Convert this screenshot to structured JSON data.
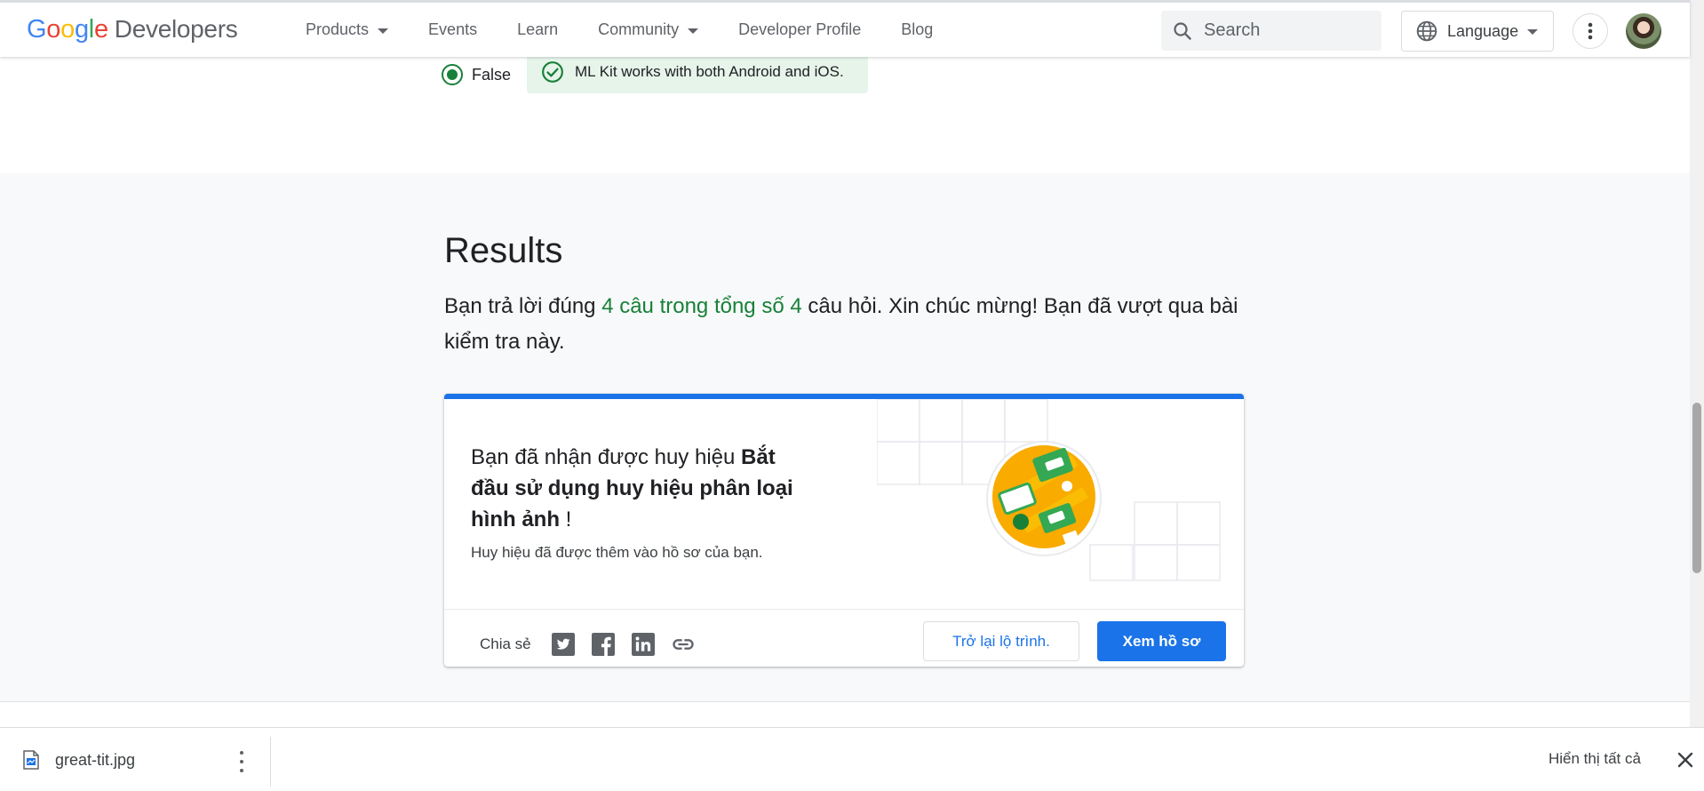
{
  "header": {
    "logo": {
      "g1": "G",
      "g2": "o",
      "g3": "o",
      "g4": "g",
      "g5": "l",
      "g6": "e",
      "product": "Developers"
    },
    "nav": [
      {
        "label": "Products",
        "dropdown": true
      },
      {
        "label": "Events",
        "dropdown": false
      },
      {
        "label": "Learn",
        "dropdown": false
      },
      {
        "label": "Community",
        "dropdown": true
      },
      {
        "label": "Developer Profile",
        "dropdown": false
      },
      {
        "label": "Blog",
        "dropdown": false
      }
    ],
    "search_placeholder": "Search",
    "language_label": "Language",
    "icons": {
      "search": "search-icon",
      "language": "globe-icon",
      "more": "more-vert-icon",
      "avatar": "user-avatar"
    }
  },
  "quiz": {
    "selected_option": "False",
    "feedback": "ML Kit works with both Android and iOS.",
    "feedback_icon": "check-circle-icon"
  },
  "results": {
    "title": "Results",
    "text_before": "Bạn trả lời đúng ",
    "text_highlight": "4 câu trong tổng số 4",
    "text_after": " câu hỏi. Xin chúc mừng! Bạn đã vượt qua bài kiểm tra này."
  },
  "badge_card": {
    "title_prefix": "Bạn đã nhận được huy hiệu ",
    "badge_name": "Bắt đầu sử dụng huy hiệu phân loại hình ảnh",
    "title_suffix": " !",
    "subtitle": "Huy hiệu đã được thêm vào hồ sơ của bạn.",
    "share_label": "Chia sẻ",
    "share_icons": [
      "twitter-icon",
      "facebook-icon",
      "linkedin-icon",
      "link-icon"
    ],
    "back_button": "Trở lại lộ trình.",
    "profile_button": "Xem hồ sơ"
  },
  "colors": {
    "primary": "#1a73e8",
    "success": "#188038",
    "success_bg": "#e6f4ea",
    "section_bg": "#f8f9fa"
  },
  "download_bar": {
    "file_name": "great-tit.jpg",
    "show_all": "Hiển thị tất cả"
  }
}
